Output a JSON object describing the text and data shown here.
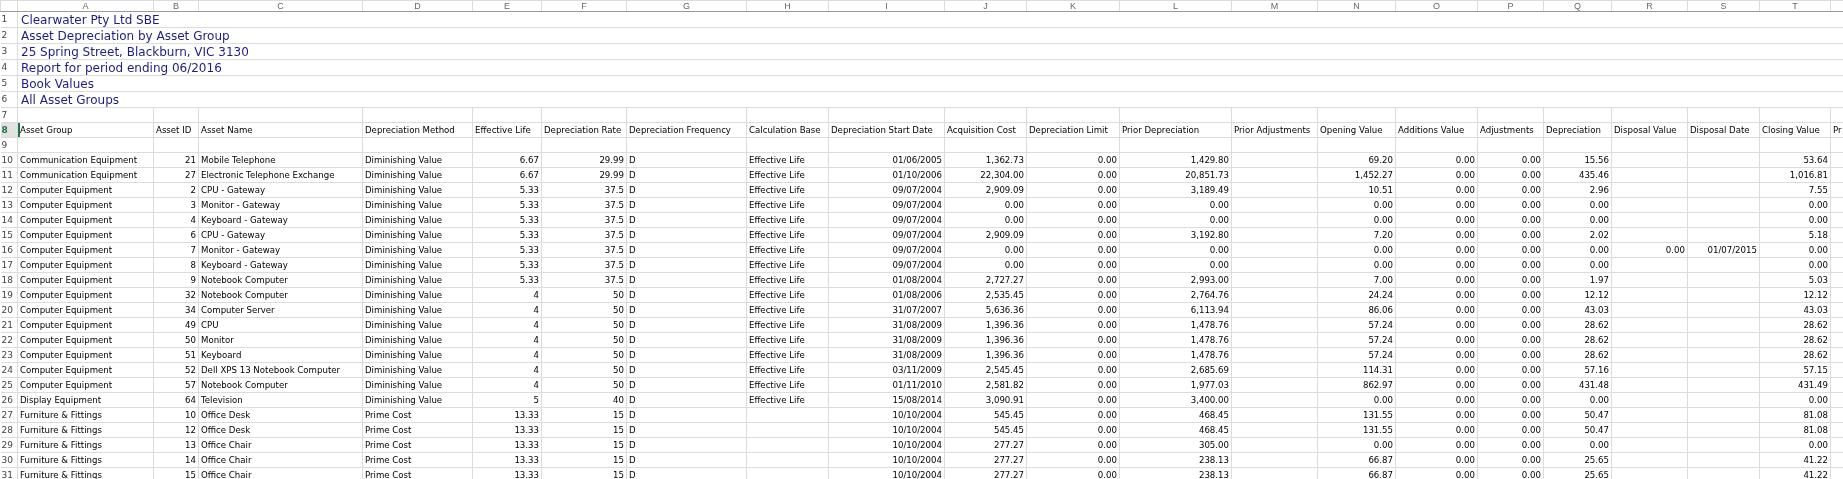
{
  "columns": [
    {
      "letter": "A",
      "kind": "text"
    },
    {
      "letter": "B",
      "kind": "number"
    },
    {
      "letter": "C",
      "kind": "text"
    },
    {
      "letter": "D",
      "kind": "text"
    },
    {
      "letter": "E",
      "kind": "number"
    },
    {
      "letter": "F",
      "kind": "number"
    },
    {
      "letter": "G",
      "kind": "text"
    },
    {
      "letter": "H",
      "kind": "text"
    },
    {
      "letter": "I",
      "kind": "number"
    },
    {
      "letter": "J",
      "kind": "number"
    },
    {
      "letter": "K",
      "kind": "number"
    },
    {
      "letter": "L",
      "kind": "number"
    },
    {
      "letter": "M",
      "kind": "number"
    },
    {
      "letter": "N",
      "kind": "number"
    },
    {
      "letter": "O",
      "kind": "number"
    },
    {
      "letter": "P",
      "kind": "number"
    },
    {
      "letter": "Q",
      "kind": "number"
    },
    {
      "letter": "R",
      "kind": "number"
    },
    {
      "letter": "S",
      "kind": "number"
    },
    {
      "letter": "T",
      "kind": "number"
    },
    {
      "kind": "text"
    }
  ],
  "rows": [
    {
      "number": "1",
      "kind": "title",
      "selected": false,
      "text": "Clearwater Pty Ltd SBE"
    },
    {
      "number": "2",
      "kind": "title",
      "selected": false,
      "text": "Asset Depreciation by Asset Group"
    },
    {
      "number": "3",
      "kind": "title",
      "selected": false,
      "text": "25 Spring Street, Blackburn, VIC 3130"
    },
    {
      "number": "4",
      "kind": "title",
      "selected": false,
      "text": "Report for period ending 06/2016"
    },
    {
      "number": "5",
      "kind": "title",
      "selected": false,
      "text": "Book Values"
    },
    {
      "number": "6",
      "kind": "title",
      "selected": false,
      "text": "All Asset Groups"
    },
    {
      "number": "7",
      "kind": "blank",
      "selected": false
    },
    {
      "number": "8",
      "kind": "header",
      "selected": true,
      "cells": [
        "Asset Group",
        "Asset ID",
        "Asset Name",
        "Depreciation Method",
        "Effective Life",
        "Depreciation Rate",
        "Depreciation Frequency",
        "Calculation Base",
        "Depreciation Start Date",
        "Acquisition Cost",
        "Depreciation Limit",
        "Prior Depreciation",
        "Prior Adjustments",
        "Opening Value",
        "Additions Value",
        "Adjustments",
        "Depreciation",
        "Disposal Value",
        "Disposal Date",
        "Closing Value",
        "Pr"
      ]
    },
    {
      "number": "9",
      "kind": "blank",
      "selected": false
    },
    {
      "number": "10",
      "kind": "data",
      "selected": false,
      "cells": [
        "Communication Equipment",
        "21",
        "Mobile Telephone",
        "Diminishing Value",
        "6.67",
        "29.99",
        "D",
        "Effective Life",
        "01/06/2005",
        "1,362.73",
        "0.00",
        "1,429.80",
        null,
        "69.20",
        "0.00",
        "0.00",
        "15.56",
        null,
        null,
        "53.64"
      ]
    },
    {
      "number": "11",
      "kind": "data",
      "selected": false,
      "cells": [
        "Communication Equipment",
        "27",
        "Electronic Telephone Exchange",
        "Diminishing Value",
        "6.67",
        "29.99",
        "D",
        "Effective Life",
        "01/10/2006",
        "22,304.00",
        "0.00",
        "20,851.73",
        null,
        "1,452.27",
        "0.00",
        "0.00",
        "435.46",
        null,
        null,
        "1,016.81"
      ]
    },
    {
      "number": "12",
      "kind": "data",
      "selected": false,
      "cells": [
        "Computer Equipment",
        "2",
        "CPU - Gateway",
        "Diminishing Value",
        "5.33",
        "37.5",
        "D",
        "Effective Life",
        "09/07/2004",
        "2,909.09",
        "0.00",
        "3,189.49",
        null,
        "10.51",
        "0.00",
        "0.00",
        "2.96",
        null,
        null,
        "7.55"
      ]
    },
    {
      "number": "13",
      "kind": "data",
      "selected": false,
      "cells": [
        "Computer Equipment",
        "3",
        "Monitor - Gateway",
        "Diminishing Value",
        "5.33",
        "37.5",
        "D",
        "Effective Life",
        "09/07/2004",
        "0.00",
        "0.00",
        "0.00",
        null,
        "0.00",
        "0.00",
        "0.00",
        "0.00",
        null,
        null,
        "0.00"
      ]
    },
    {
      "number": "14",
      "kind": "data",
      "selected": false,
      "cells": [
        "Computer Equipment",
        "4",
        "Keyboard - Gateway",
        "Diminishing Value",
        "5.33",
        "37.5",
        "D",
        "Effective Life",
        "09/07/2004",
        "0.00",
        "0.00",
        "0.00",
        null,
        "0.00",
        "0.00",
        "0.00",
        "0.00",
        null,
        null,
        "0.00"
      ]
    },
    {
      "number": "15",
      "kind": "data",
      "selected": false,
      "cells": [
        "Computer Equipment",
        "6",
        "CPU - Gateway",
        "Diminishing Value",
        "5.33",
        "37.5",
        "D",
        "Effective Life",
        "09/07/2004",
        "2,909.09",
        "0.00",
        "3,192.80",
        null,
        "7.20",
        "0.00",
        "0.00",
        "2.02",
        null,
        null,
        "5.18"
      ]
    },
    {
      "number": "16",
      "kind": "data",
      "selected": false,
      "cells": [
        "Computer Equipment",
        "7",
        "Monitor - Gateway",
        "Diminishing Value",
        "5.33",
        "37.5",
        "D",
        "Effective Life",
        "09/07/2004",
        "0.00",
        "0.00",
        "0.00",
        null,
        "0.00",
        "0.00",
        "0.00",
        "0.00",
        "0.00",
        "01/07/2015",
        "0.00"
      ]
    },
    {
      "number": "17",
      "kind": "data",
      "selected": false,
      "cells": [
        "Computer Equipment",
        "8",
        "Keyboard - Gateway",
        "Diminishing Value",
        "5.33",
        "37.5",
        "D",
        "Effective Life",
        "09/07/2004",
        "0.00",
        "0.00",
        "0.00",
        null,
        "0.00",
        "0.00",
        "0.00",
        "0.00",
        null,
        null,
        "0.00"
      ]
    },
    {
      "number": "18",
      "kind": "data",
      "selected": false,
      "cells": [
        "Computer Equipment",
        "9",
        "Notebook Computer",
        "Diminishing Value",
        "5.33",
        "37.5",
        "D",
        "Effective Life",
        "01/08/2004",
        "2,727.27",
        "0.00",
        "2,993.00",
        null,
        "7.00",
        "0.00",
        "0.00",
        "1.97",
        null,
        null,
        "5.03"
      ]
    },
    {
      "number": "19",
      "kind": "data",
      "selected": false,
      "cells": [
        "Computer Equipment",
        "32",
        "Notebook Computer",
        "Diminishing Value",
        "4",
        "50",
        "D",
        "Effective Life",
        "01/08/2006",
        "2,535.45",
        "0.00",
        "2,764.76",
        null,
        "24.24",
        "0.00",
        "0.00",
        "12.12",
        null,
        null,
        "12.12"
      ]
    },
    {
      "number": "20",
      "kind": "data",
      "selected": false,
      "cells": [
        "Computer Equipment",
        "34",
        "Computer Server",
        "Diminishing Value",
        "4",
        "50",
        "D",
        "Effective Life",
        "31/07/2007",
        "5,636.36",
        "0.00",
        "6,113.94",
        null,
        "86.06",
        "0.00",
        "0.00",
        "43.03",
        null,
        null,
        "43.03"
      ]
    },
    {
      "number": "21",
      "kind": "data",
      "selected": false,
      "cells": [
        "Computer Equipment",
        "49",
        "CPU",
        "Diminishing Value",
        "4",
        "50",
        "D",
        "Effective Life",
        "31/08/2009",
        "1,396.36",
        "0.00",
        "1,478.76",
        null,
        "57.24",
        "0.00",
        "0.00",
        "28.62",
        null,
        null,
        "28.62"
      ]
    },
    {
      "number": "22",
      "kind": "data",
      "selected": false,
      "cells": [
        "Computer Equipment",
        "50",
        "Monitor",
        "Diminishing Value",
        "4",
        "50",
        "D",
        "Effective Life",
        "31/08/2009",
        "1,396.36",
        "0.00",
        "1,478.76",
        null,
        "57.24",
        "0.00",
        "0.00",
        "28.62",
        null,
        null,
        "28.62"
      ]
    },
    {
      "number": "23",
      "kind": "data",
      "selected": false,
      "cells": [
        "Computer Equipment",
        "51",
        "Keyboard",
        "Diminishing Value",
        "4",
        "50",
        "D",
        "Effective Life",
        "31/08/2009",
        "1,396.36",
        "0.00",
        "1,478.76",
        null,
        "57.24",
        "0.00",
        "0.00",
        "28.62",
        null,
        null,
        "28.62"
      ]
    },
    {
      "number": "24",
      "kind": "data",
      "selected": false,
      "cells": [
        "Computer Equipment",
        "52",
        "Dell XPS 13 Notebook Computer",
        "Diminishing Value",
        "4",
        "50",
        "D",
        "Effective Life",
        "03/11/2009",
        "2,545.45",
        "0.00",
        "2,685.69",
        null,
        "114.31",
        "0.00",
        "0.00",
        "57.16",
        null,
        null,
        "57.15"
      ]
    },
    {
      "number": "25",
      "kind": "data",
      "selected": false,
      "cells": [
        "Computer Equipment",
        "57",
        "Notebook Computer",
        "Diminishing Value",
        "4",
        "50",
        "D",
        "Effective Life",
        "01/11/2010",
        "2,581.82",
        "0.00",
        "1,977.03",
        null,
        "862.97",
        "0.00",
        "0.00",
        "431.48",
        null,
        null,
        "431.49"
      ]
    },
    {
      "number": "26",
      "kind": "data",
      "selected": false,
      "cells": [
        "Display Equipment",
        "64",
        "Television",
        "Diminishing Value",
        "5",
        "40",
        "D",
        "Effective Life",
        "15/08/2014",
        "3,090.91",
        "0.00",
        "3,400.00",
        null,
        "0.00",
        "0.00",
        "0.00",
        "0.00",
        null,
        null,
        "0.00"
      ]
    },
    {
      "number": "27",
      "kind": "data",
      "selected": false,
      "cells": [
        "Furniture & Fittings",
        "10",
        "Office Desk",
        "Prime Cost",
        "13.33",
        "15",
        "D",
        null,
        "10/10/2004",
        "545.45",
        "0.00",
        "468.45",
        null,
        "131.55",
        "0.00",
        "0.00",
        "50.47",
        null,
        null,
        "81.08"
      ]
    },
    {
      "number": "28",
      "kind": "data",
      "selected": false,
      "cells": [
        "Furniture & Fittings",
        "12",
        "Office Desk",
        "Prime Cost",
        "13.33",
        "15",
        "D",
        null,
        "10/10/2004",
        "545.45",
        "0.00",
        "468.45",
        null,
        "131.55",
        "0.00",
        "0.00",
        "50.47",
        null,
        null,
        "81.08"
      ]
    },
    {
      "number": "29",
      "kind": "data",
      "selected": false,
      "cells": [
        "Furniture & Fittings",
        "13",
        "Office Chair",
        "Prime Cost",
        "13.33",
        "15",
        "D",
        null,
        "10/10/2004",
        "277.27",
        "0.00",
        "305.00",
        null,
        "0.00",
        "0.00",
        "0.00",
        "0.00",
        null,
        null,
        "0.00"
      ]
    },
    {
      "number": "30",
      "kind": "data",
      "selected": false,
      "cells": [
        "Furniture & Fittings",
        "14",
        "Office Chair",
        "Prime Cost",
        "13.33",
        "15",
        "D",
        null,
        "10/10/2004",
        "277.27",
        "0.00",
        "238.13",
        null,
        "66.87",
        "0.00",
        "0.00",
        "25.65",
        null,
        null,
        "41.22"
      ]
    },
    {
      "number": "31",
      "kind": "data",
      "selected": false,
      "cells": [
        "Furniture & Fittings",
        "15",
        "Office Chair",
        "Prime Cost",
        "13.33",
        "15",
        "D",
        null,
        "10/10/2004",
        "277.27",
        "0.00",
        "238.13",
        null,
        "66.87",
        "0.00",
        "0.00",
        "25.65",
        null,
        null,
        "41.22"
      ]
    }
  ]
}
